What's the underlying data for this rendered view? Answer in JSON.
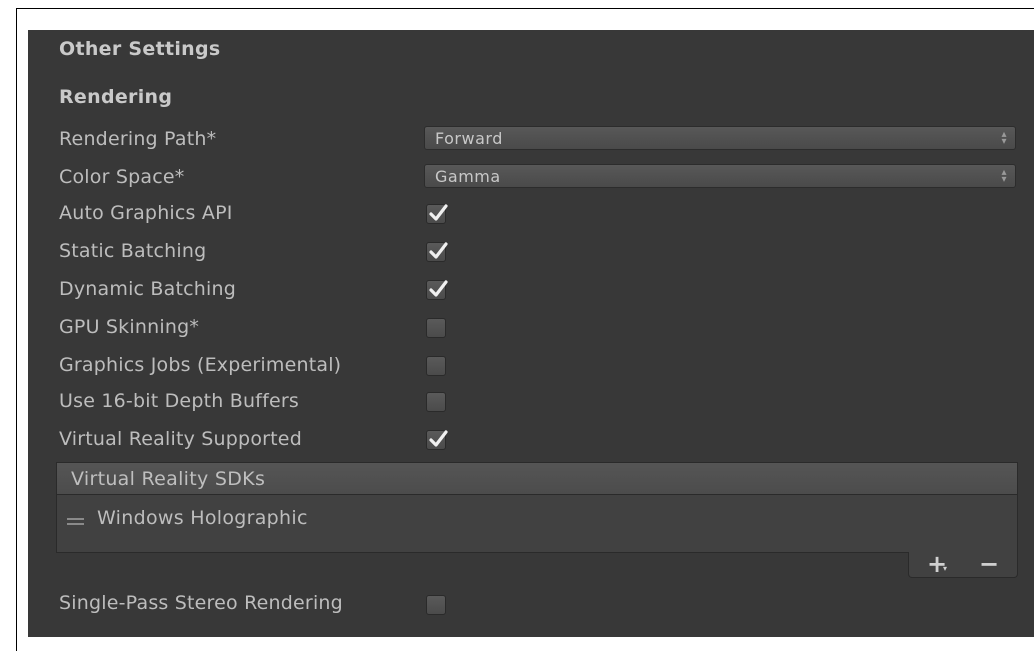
{
  "sections": {
    "other_settings": "Other Settings",
    "rendering": "Rendering"
  },
  "rendering_path": {
    "label": "Rendering Path*",
    "value": "Forward"
  },
  "color_space": {
    "label": "Color Space*",
    "value": "Gamma"
  },
  "options": [
    {
      "label": "Auto Graphics API",
      "checked": true
    },
    {
      "label": "Static Batching",
      "checked": true
    },
    {
      "label": "Dynamic Batching",
      "checked": true
    },
    {
      "label": "GPU Skinning*",
      "checked": false
    },
    {
      "label": "Graphics Jobs (Experimental)",
      "checked": false
    },
    {
      "label": "Use 16-bit Depth Buffers",
      "checked": false
    },
    {
      "label": "Virtual Reality Supported",
      "checked": true
    }
  ],
  "vr_sdks": {
    "header": "Virtual Reality SDKs",
    "items": [
      "Windows Holographic"
    ],
    "add_icon": "plus-icon",
    "remove_icon": "minus-icon"
  },
  "single_pass": {
    "label": "Single-Pass Stereo Rendering",
    "checked": false
  },
  "colors": {
    "panel_bg": "#383838",
    "text": "#bdbdbd"
  }
}
